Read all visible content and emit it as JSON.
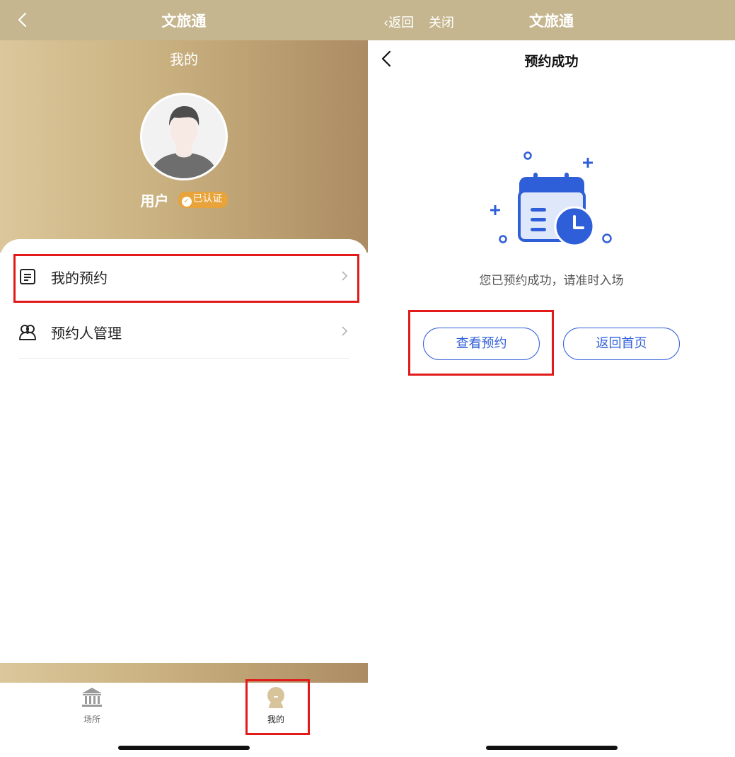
{
  "left": {
    "topbar": {
      "title": "文旅通"
    },
    "profile": {
      "heading": "我的",
      "user_name": "用户",
      "verified_badge": "已认证"
    },
    "menu": [
      {
        "label": "我的预约",
        "icon": "document-icon"
      },
      {
        "label": "预约人管理",
        "icon": "people-icon"
      }
    ],
    "tabbar": {
      "tabs": [
        {
          "label": "场所",
          "icon": "museum-icon",
          "active": false
        },
        {
          "label": "我的",
          "icon": "user-icon",
          "active": true
        }
      ]
    }
  },
  "right": {
    "topbar": {
      "back_label": "返回",
      "close_label": "关闭",
      "title": "文旅通"
    },
    "page_title": "预约成功",
    "message": "您已预约成功，请准时入场",
    "buttons": {
      "view_booking": "查看预约",
      "back_home": "返回首页"
    }
  },
  "colors": {
    "topbar": "#c5b68f",
    "gold_gradient_start": "#dbc79b",
    "gold_gradient_end": "#ac8c63",
    "accent_blue": "#2f5fd8",
    "badge_orange": "#e8a33a",
    "highlight_red": "#e21a1a"
  }
}
